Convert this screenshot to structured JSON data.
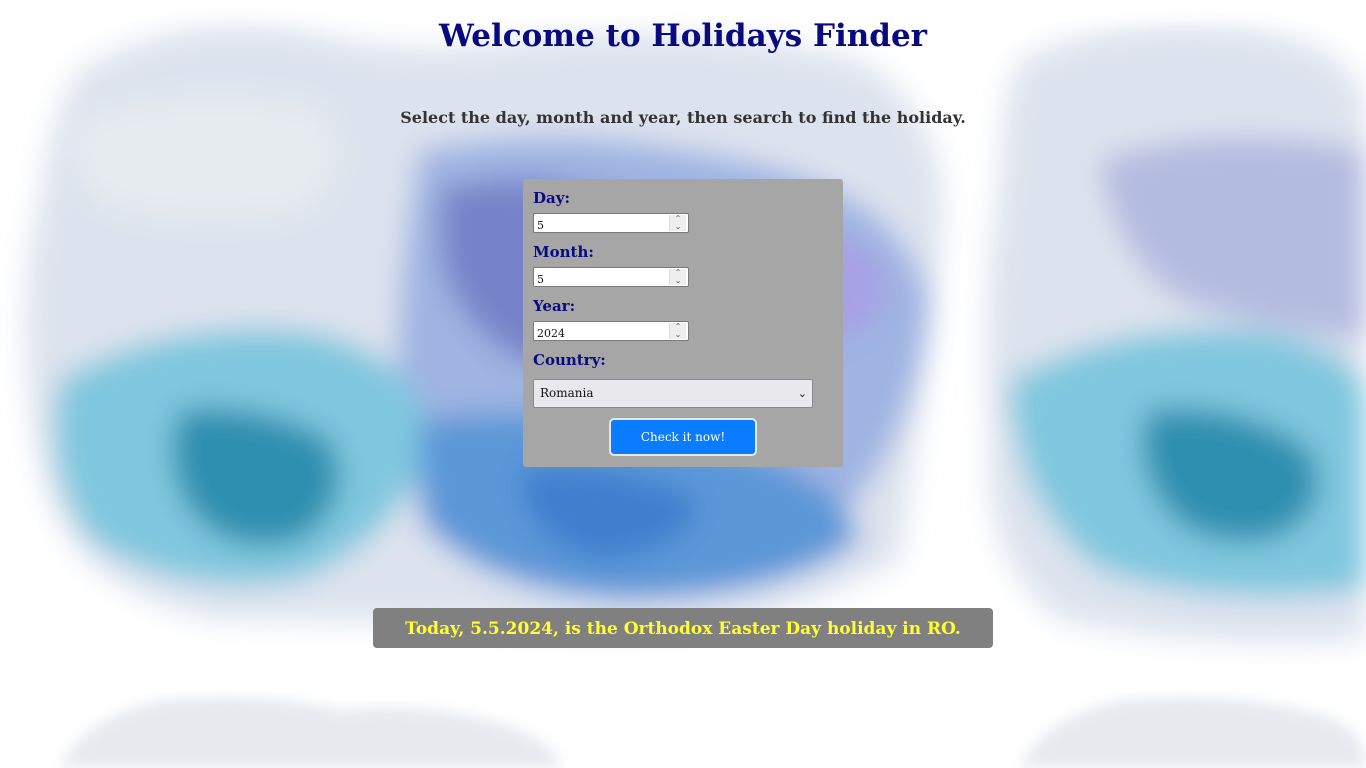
{
  "page": {
    "title": "Welcome to Holidays Finder",
    "subtitle": "Select the day, month and year, then search to find the holiday."
  },
  "form": {
    "day": {
      "label": "Day:",
      "value": "5"
    },
    "month": {
      "label": "Month:",
      "value": "5"
    },
    "year": {
      "label": "Year:",
      "value": "2024"
    },
    "country": {
      "label": "Country:",
      "selected": "Romania"
    },
    "submit_label": "Check it now!"
  },
  "result": {
    "message": "Today, 5.5.2024, is the Orthodox Easter Day holiday in RO."
  },
  "colors": {
    "title": "#0a0a80",
    "card": "#a6a6a6",
    "button": "#0a7cff",
    "result_bg": "#808080",
    "result_text": "#ffff33"
  }
}
